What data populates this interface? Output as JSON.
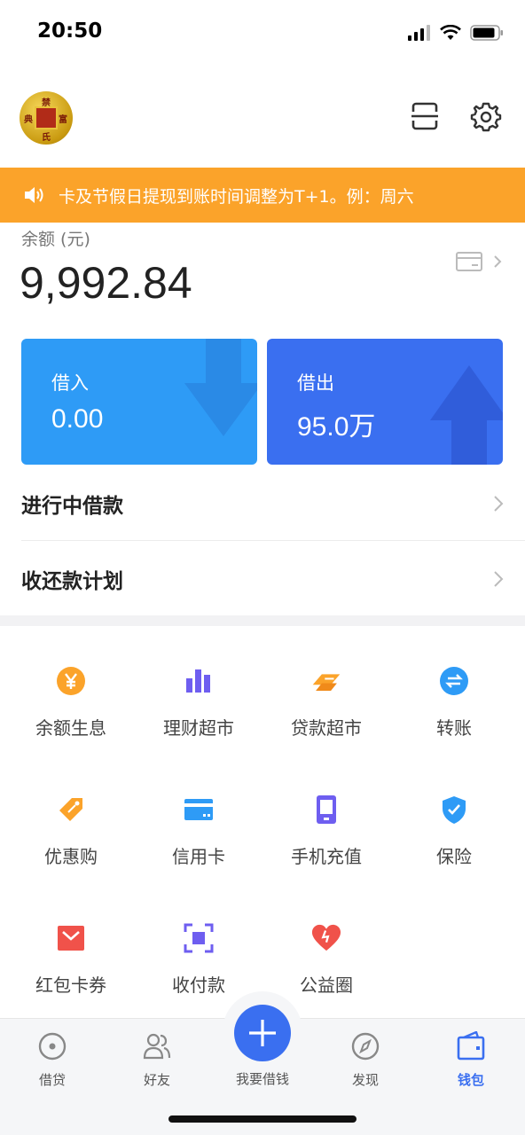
{
  "status_bar": {
    "time": "20:50"
  },
  "header": {
    "avatar_text": [
      "禁",
      "富",
      "典",
      "氏"
    ]
  },
  "notice": {
    "text": "卡及节假日提现到账时间调整为T+1。例：周六"
  },
  "balance": {
    "label": "余额 (元)",
    "value": "9,992.84"
  },
  "cards": {
    "borrow_in": {
      "label": "借入",
      "value": "0.00"
    },
    "borrow_out": {
      "label": "借出",
      "value": "95.0万"
    }
  },
  "list": {
    "ongoing": "进行中借款",
    "plan": "收还款计划"
  },
  "grid": [
    {
      "label": "余额生息",
      "icon": "yen-coin-icon",
      "color": "#fba32a"
    },
    {
      "label": "理财超市",
      "icon": "bar-chart-icon",
      "color": "#6e5ef0"
    },
    {
      "label": "贷款超市",
      "icon": "cash-stack-icon",
      "color": "#fba32a"
    },
    {
      "label": "转账",
      "icon": "transfer-icon",
      "color": "#2e9bf6"
    },
    {
      "label": "优惠购",
      "icon": "tag-icon",
      "color": "#fba32a"
    },
    {
      "label": "信用卡",
      "icon": "credit-card-icon",
      "color": "#2e9bf6"
    },
    {
      "label": "手机充值",
      "icon": "phone-icon",
      "color": "#6e5ef0"
    },
    {
      "label": "保险",
      "icon": "shield-check-icon",
      "color": "#2e9bf6"
    },
    {
      "label": "红包卡券",
      "icon": "red-envelope-icon",
      "color": "#f0524a"
    },
    {
      "label": "收付款",
      "icon": "scan-frame-icon",
      "color": "#6e5ef0"
    },
    {
      "label": "公益圈",
      "icon": "heart-icon",
      "color": "#f0524a"
    }
  ],
  "tabbar": {
    "loan": "借贷",
    "friends": "好友",
    "borrow": "我要借钱",
    "discover": "发现",
    "wallet": "钱包"
  },
  "colors": {
    "notice_bg": "#fba32a",
    "card_in": "#2e9bf6",
    "card_out": "#3a6ff0",
    "accent": "#3a6ff0"
  }
}
